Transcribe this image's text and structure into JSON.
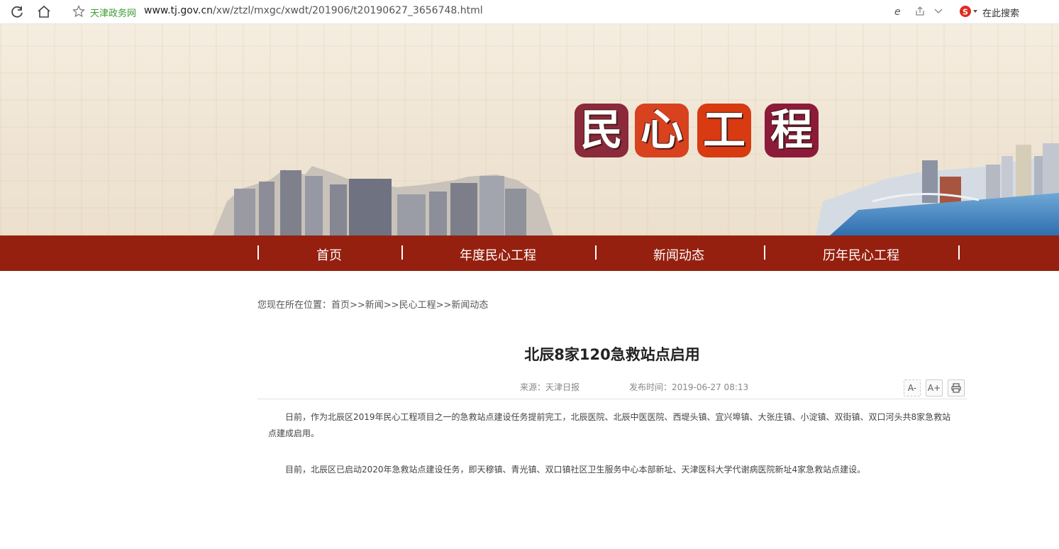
{
  "browser": {
    "site_name": "天津政务网",
    "url_host": "www.tj.gov.cn",
    "url_path": "/xw/ztzl/mxgc/xwdt/201906/t20190627_3656748.html",
    "search_label": "在此搜索"
  },
  "banner": {
    "title_chars": [
      "民",
      "心",
      "工",
      "程"
    ]
  },
  "nav": {
    "items": [
      "首页",
      "年度民心工程",
      "新闻动态",
      "历年民心工程"
    ]
  },
  "breadcrumb": "您现在所在位置：首页>>新闻>>民心工程>>新闻动态",
  "article": {
    "title": "北辰8家120急救站点启用",
    "source": "来源：天津日报",
    "published": "发布时间：2019-06-27 08:13",
    "tools": {
      "font_smaller": "A-",
      "font_larger": "A+"
    },
    "paragraphs": [
      "日前，作为北辰区2019年民心工程项目之一的急救站点建设任务提前完工，北辰医院、北辰中医医院、西堤头镇、宜兴埠镇、大张庄镇、小淀镇、双街镇、双口河头共8家急救站点建成启用。",
      "目前，北辰区已启动2020年急救站点建设任务，即天穆镇、青光镇、双口镇社区卫生服务中心本部新址、天津医科大学代谢病医院新址4家急救站点建设。"
    ]
  },
  "colors": {
    "nav_bg": "#95200f",
    "site_name": "#3a9b2e"
  }
}
